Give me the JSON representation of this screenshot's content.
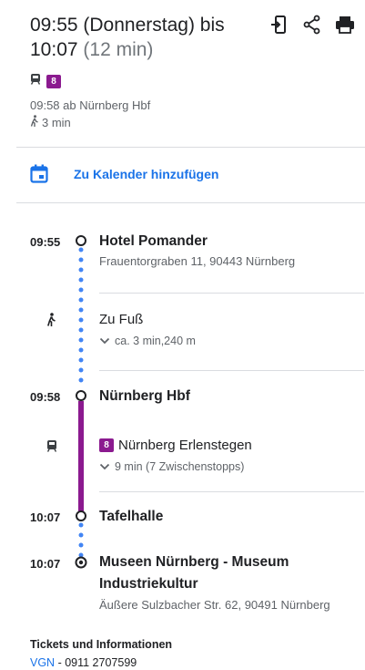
{
  "header": {
    "title_main": "09:55 (Donnerstag) bis 10:07",
    "title_duration": "(12 min)",
    "line_badge": "8",
    "departure": "09:58 ab Nürnberg Hbf",
    "walk": "3 min"
  },
  "actions": {
    "open_icon": "open-in-app-icon",
    "share_icon": "share-icon",
    "print_icon": "print-icon"
  },
  "calendar": {
    "label": "Zu Kalender hinzufügen"
  },
  "route": {
    "stop1": {
      "time": "09:55",
      "name": "Hotel Pomander",
      "address": "Frauentorgraben 11, 90443 Nürnberg"
    },
    "walk_segment": {
      "title": "Zu Fuß",
      "detail": "ca. 3 min,240 m"
    },
    "stop2": {
      "time": "09:58",
      "name": "Nürnberg Hbf"
    },
    "tram_segment": {
      "line": "8",
      "title": "Nürnberg Erlenstegen",
      "detail": "9 min (7 Zwischenstopps)"
    },
    "stop3": {
      "time": "10:07",
      "name": "Tafelhalle"
    },
    "stop4": {
      "time": "10:07",
      "name_line1": "Museen Nürnberg - Museum",
      "name_line2": "Industriekultur",
      "address": "Äußere Sulzbacher Str. 62, 90491 Nürnberg"
    }
  },
  "footer": {
    "title": "Tickets und Informationen",
    "link": "VGN",
    "phone": " - 0911 2707599"
  },
  "colors": {
    "accent": "#1a73e8",
    "line8": "#8b1a8f",
    "walk_dots": "#4285f4"
  }
}
